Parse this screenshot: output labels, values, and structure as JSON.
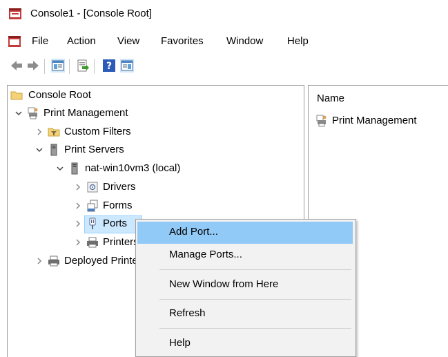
{
  "window": {
    "title": "Console1 - [Console Root]"
  },
  "menubar": {
    "items": [
      "File",
      "Action",
      "View",
      "Favorites",
      "Window",
      "Help"
    ]
  },
  "toolbar": {
    "buttons": [
      "back-arrow-icon",
      "forward-arrow-icon",
      "show-hide-console-tree-icon",
      "export-list-icon",
      "help-icon",
      "show-hide-action-pane-icon"
    ]
  },
  "tree": {
    "console_root": "Console Root",
    "print_management": "Print Management",
    "custom_filters": "Custom Filters",
    "print_servers": "Print Servers",
    "server": "nat-win10vm3 (local)",
    "drivers": "Drivers",
    "forms": "Forms",
    "ports": "Ports",
    "printers": "Printers",
    "deployed_printers": "Deployed Printers"
  },
  "results": {
    "column_header": "Name",
    "items": [
      "Print Management"
    ]
  },
  "context_menu": {
    "items": [
      "Add Port...",
      "Manage Ports...",
      "New Window from Here",
      "Refresh",
      "Help"
    ],
    "highlighted": "Add Port..."
  },
  "colors": {
    "menu_highlight": "#91c9f7",
    "tree_selection": "#cce8ff",
    "menu_background": "#f2f2f2"
  }
}
